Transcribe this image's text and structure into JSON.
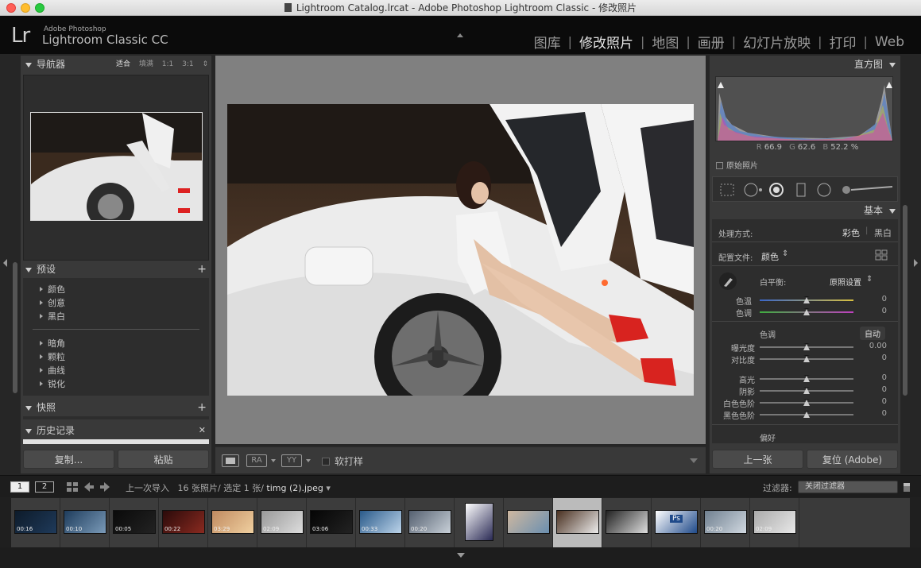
{
  "window": {
    "title": "Lightroom Catalog.lrcat - Adobe Photoshop Lightroom Classic - 修改照片"
  },
  "identity": {
    "logo": "Lr",
    "brand_small": "Adobe Photoshop",
    "brand_name": "Lightroom Classic CC"
  },
  "modules": [
    "图库",
    "修改照片",
    "地图",
    "画册",
    "幻灯片放映",
    "打印",
    "Web"
  ],
  "active_module": "修改照片",
  "navigator": {
    "title": "导航器",
    "zoom_options": [
      "适合",
      "填满",
      "1:1",
      "3:1"
    ],
    "selected_zoom": "适合"
  },
  "presets": {
    "title": "预设",
    "group1": [
      "颜色",
      "创意",
      "黑白"
    ],
    "group2": [
      "暗角",
      "颗粒",
      "曲线",
      "锐化"
    ]
  },
  "snapshots": {
    "title": "快照"
  },
  "history": {
    "title": "历史记录"
  },
  "left_buttons": {
    "copy": "复制...",
    "paste": "粘贴"
  },
  "toolbar": {
    "ra": "RA",
    "yy": "YY",
    "soft_proof": "软打样"
  },
  "histogram": {
    "title": "直方图",
    "r": "66.9",
    "g": "62.6",
    "b": "52.2",
    "unit": "%",
    "original_photo": "原始照片"
  },
  "basic": {
    "title": "基本",
    "treatment_label": "处理方式:",
    "treatment_color": "彩色",
    "treatment_bw": "黑白",
    "profile_label": "配置文件:",
    "profile_value": "颜色",
    "wb_label": "白平衡:",
    "wb_value": "原照设置",
    "temp_label": "色温",
    "temp_value": "0",
    "tint_label": "色调",
    "tint_value": "0",
    "tone_label": "色调",
    "auto_label": "自动",
    "exposure_label": "曝光度",
    "exposure_value": "0.00",
    "contrast_label": "对比度",
    "contrast_value": "0",
    "highlights_label": "高光",
    "highlights_value": "0",
    "shadows_label": "阴影",
    "shadows_value": "0",
    "whites_label": "白色色阶",
    "whites_value": "0",
    "blacks_label": "黑色色阶",
    "blacks_value": "0",
    "presence_label": "偏好"
  },
  "right_buttons": {
    "previous": "上一张",
    "reset": "复位 (Adobe)"
  },
  "filmbar": {
    "screen1": "1",
    "screen2": "2",
    "source": "上一次导入",
    "count": "16 张照片/ 选定 1 张/",
    "filename": "timg (2).jpeg",
    "filter_label": "过滤器:",
    "filter_value": "关闭过滤器"
  },
  "filmstrip": [
    {
      "duration": "00:16"
    },
    {
      "duration": "00:10"
    },
    {
      "duration": "00:05"
    },
    {
      "duration": "00:22"
    },
    {
      "duration": "03:29"
    },
    {
      "duration": "02:09"
    },
    {
      "duration": "03:06"
    },
    {
      "duration": "00:33"
    },
    {
      "duration": "00:20"
    },
    {
      "duration": ""
    },
    {
      "duration": ""
    },
    {
      "duration": ""
    },
    {
      "duration": ""
    },
    {
      "duration": ""
    },
    {
      "duration": "00:20"
    },
    {
      "duration": "02:09"
    }
  ],
  "colors": {
    "accent": "#e6e6e6",
    "panel": "#393939",
    "center_bg": "#808080"
  }
}
